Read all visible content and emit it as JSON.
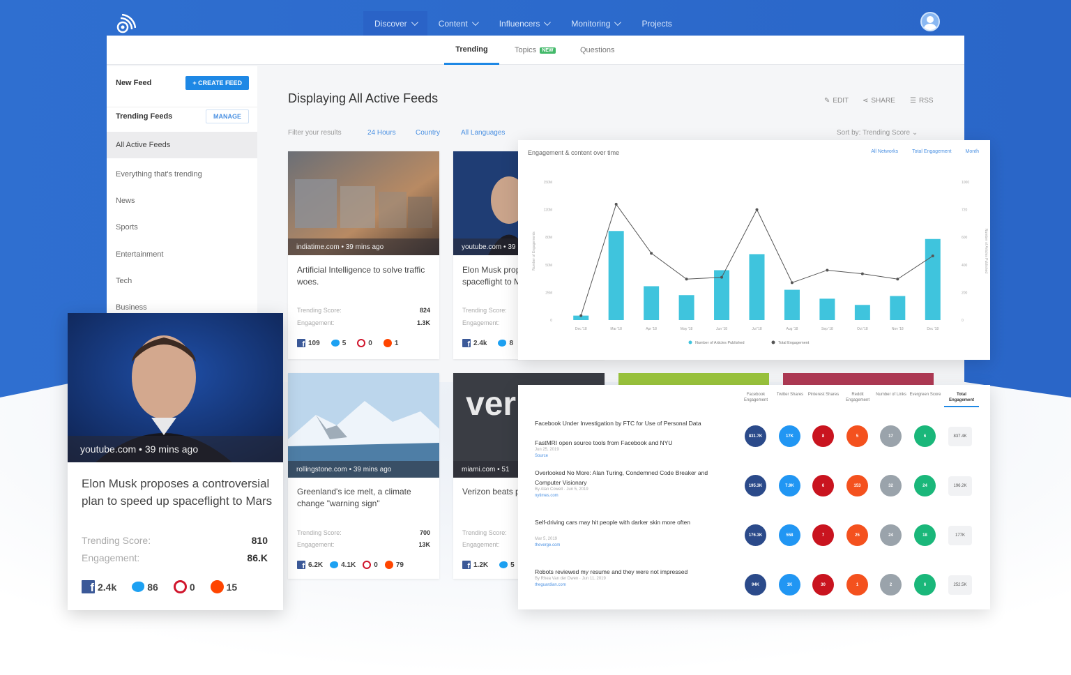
{
  "colors": {
    "brand_blue": "#2b6ed3",
    "accent": "#1e88e5",
    "bar": "#3fc4dd",
    "line": "#555555",
    "facebook": "#3b5998",
    "twitter": "#1da1f2",
    "pinterest": "#d0152c",
    "reddit": "#ff4500"
  },
  "nav": {
    "items": [
      {
        "label": "Discover",
        "dropdown": true
      },
      {
        "label": "Content",
        "dropdown": true
      },
      {
        "label": "Influencers",
        "dropdown": true
      },
      {
        "label": "Monitoring",
        "dropdown": true
      },
      {
        "label": "Projects",
        "dropdown": false
      }
    ]
  },
  "subtabs": {
    "trending": "Trending",
    "topics": "Topics",
    "topics_badge": "NEW",
    "questions": "Questions"
  },
  "sidebar": {
    "new_feed": "New Feed",
    "create_feed": "+ CREATE FEED",
    "trending_feeds": "Trending Feeds",
    "manage": "MANAGE",
    "items": [
      "All Active Feeds",
      "Everything that's trending",
      "News",
      "Sports",
      "Entertainment",
      "Tech",
      "Business"
    ]
  },
  "main": {
    "title": "Displaying All Active Feeds",
    "actions": {
      "edit": "EDIT",
      "share": "SHARE",
      "rss": "RSS"
    },
    "filter_label": "Filter your results",
    "filters": [
      "24 Hours",
      "Country",
      "All Languages"
    ],
    "sort_label": "Sort by: Trending Score"
  },
  "cards": [
    {
      "source": "indiatime.com • 39 mins ago",
      "title": "Artificial Intelligence to solve traffic woes.",
      "score_label": "Trending Score:",
      "score": "824",
      "eng_label": "Engagement:",
      "eng": "1.3K",
      "fb": "109",
      "tw": "5",
      "pin": "0",
      "rd": "1"
    },
    {
      "source": "youtube.com • 39",
      "title": "Elon Musk prop controversial pl spaceflight to M",
      "score_label": "Trending Score:",
      "eng_label": "Engagement:",
      "fb": "2.4k",
      "tw": "8"
    },
    {
      "source": "rollingstone.com • 39 mins ago",
      "title": "Greenland's ice melt, a climate change \"warning sign\"",
      "score_label": "Trending Score:",
      "score": "700",
      "eng_label": "Engagement:",
      "eng": "13K",
      "fb": "6.2K",
      "tw": "4.1K",
      "pin": "0",
      "rd": "79"
    },
    {
      "source": "miami.com • 51",
      "title": "Verizon beats p monthly phone",
      "score_label": "Trending Score:",
      "eng_label": "Engagement:",
      "fb": "1.2K",
      "tw": "5"
    }
  ],
  "bigcard": {
    "source": "youtube.com • 39 mins ago",
    "title": "Elon Musk proposes a controversial plan to speed up spaceflight to Mars",
    "score_label": "Trending Score:",
    "score": "810",
    "eng_label": "Engagement:",
    "eng": "86.K",
    "fb": "2.4k",
    "tw": "86",
    "pin": "0",
    "rd": "15"
  },
  "chart_panel": {
    "title": "Engagement & content over time",
    "tabs": [
      "All Networks",
      "Total Engagement",
      "Month"
    ]
  },
  "chart_data": {
    "type": "bar",
    "title": "Engagement & content over time",
    "categories": [
      "Dec '18",
      "Mar '18",
      "Apr '18",
      "May '18",
      "Jun '18",
      "Jul '18",
      "Aug '18",
      "Sep '18",
      "Oct '18",
      "Nov '18",
      "Dec '18"
    ],
    "yticks_left": [
      "0",
      "25M",
      "50M",
      "80M",
      "120M",
      "150M"
    ],
    "yticks_right": [
      "0",
      "200",
      "400",
      "600",
      "720",
      "1000"
    ],
    "ylabel": "Number of Engagements",
    "ylabel_right": "Number of Articles Published",
    "series": [
      {
        "name": "Number of Articles Published",
        "kind": "bar",
        "values": [
          5,
          100,
          38,
          28,
          56,
          74,
          34,
          24,
          17,
          27,
          91
        ]
      },
      {
        "name": "Total Engagement",
        "kind": "line",
        "values": [
          5,
          130,
          75,
          46,
          48,
          124,
          42,
          56,
          52,
          46,
          72
        ]
      }
    ],
    "ylim": [
      0,
      155
    ]
  },
  "table": {
    "headers": [
      "Facebook Engagement",
      "Twitter Shares",
      "Pinterest Shares",
      "Reddit Engagement",
      "Number of Links",
      "Evergreen Score",
      "Total Engagement"
    ],
    "rows": [
      {
        "title": "Facebook Under Investigation by FTC for Use of Personal Data",
        "subtitle": "FastMRI open source tools from Facebook and NYU",
        "meta": "Jun 25, 2019",
        "link": "Source",
        "values": [
          "831.7K",
          "17K",
          "8",
          "5",
          "17",
          "6"
        ],
        "total": "837.4K"
      },
      {
        "title": "Overlooked No More: Alan Turing, Condemned Code Breaker and Computer Visionary",
        "meta": "By Alan Cowell · Jun 5, 2019",
        "link": "nytimes.com",
        "values": [
          "195.3K",
          "7.9K",
          "6",
          "153",
          "32",
          "24"
        ],
        "total": "196.2K"
      },
      {
        "title": "Self-driving cars may hit people with darker skin more often",
        "meta": "Mar 5, 2019",
        "link": "theverge.com",
        "values": [
          "176.3K",
          "558",
          "7",
          "25",
          "24",
          "18"
        ],
        "total": "177K"
      },
      {
        "title": "Robots reviewed my resume and they were not impressed",
        "meta": "By Rhea Van der Dwen · Jun 11, 2019",
        "link": "theguardian.com",
        "values": [
          "94K",
          "1K",
          "30",
          "1",
          "2",
          "6"
        ],
        "total": "252.5K"
      }
    ]
  }
}
